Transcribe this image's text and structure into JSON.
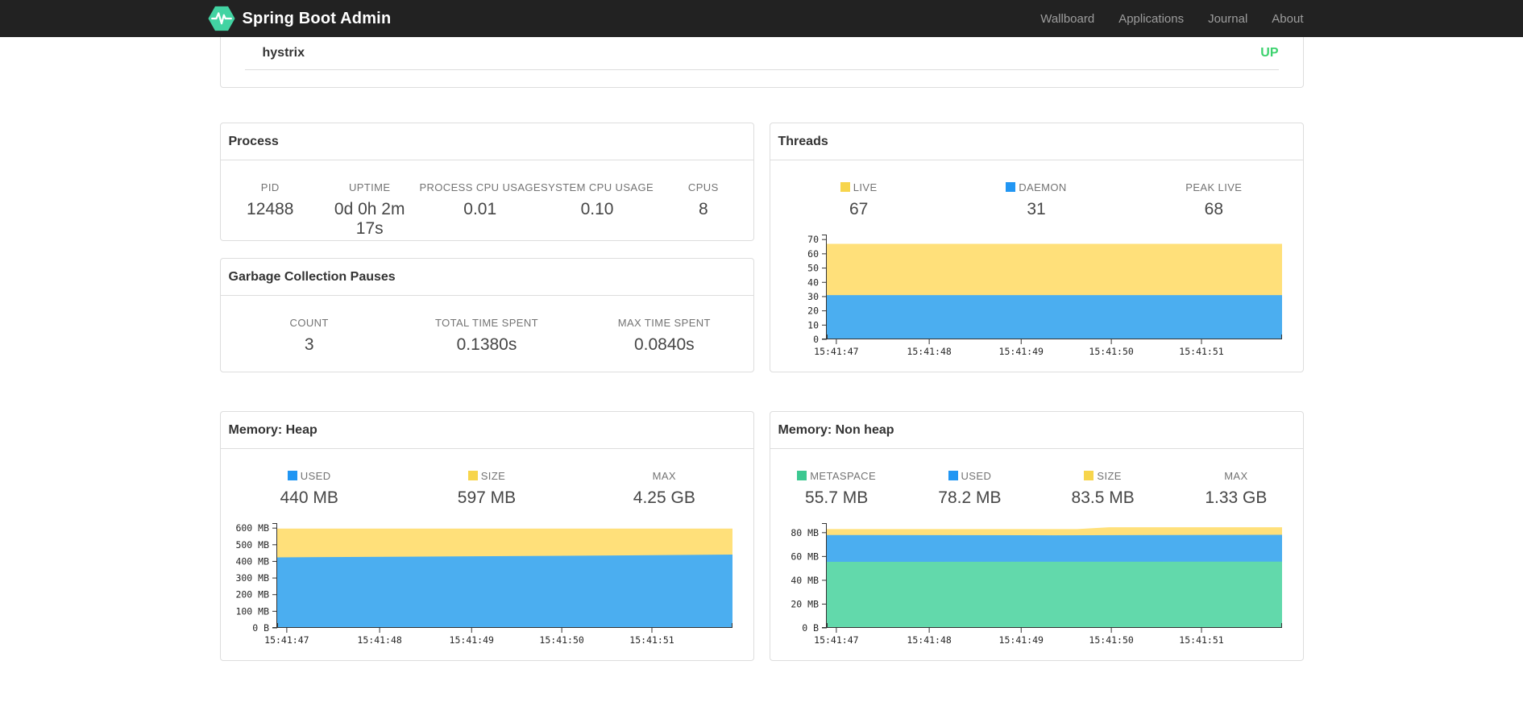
{
  "navbar": {
    "brand": "Spring Boot Admin",
    "items": [
      {
        "label": "Wallboard"
      },
      {
        "label": "Applications"
      },
      {
        "label": "Journal"
      },
      {
        "label": "About"
      }
    ]
  },
  "health": {
    "name": "hystrix",
    "status": "UP",
    "status_color": "#3cd26e"
  },
  "process": {
    "title": "Process",
    "stats": [
      {
        "label": "PID",
        "value": "12488"
      },
      {
        "label": "UPTIME",
        "value": "0d 0h 2m 17s"
      },
      {
        "label": "PROCESS CPU USAGE",
        "value": "0.01"
      },
      {
        "label": "SYSTEM CPU USAGE",
        "value": "0.10"
      },
      {
        "label": "CPUS",
        "value": "8"
      }
    ]
  },
  "gc": {
    "title": "Garbage Collection Pauses",
    "stats": [
      {
        "label": "COUNT",
        "value": "3"
      },
      {
        "label": "TOTAL TIME SPENT",
        "value": "0.1380s"
      },
      {
        "label": "MAX TIME SPENT",
        "value": "0.0840s"
      }
    ]
  },
  "threads": {
    "title": "Threads",
    "stats": [
      {
        "label": "LIVE",
        "value": "67",
        "marker": "#f7d54c"
      },
      {
        "label": "DAEMON",
        "value": "31",
        "marker": "#2196f3"
      },
      {
        "label": "PEAK LIVE",
        "value": "68"
      }
    ]
  },
  "memory_heap": {
    "title": "Memory: Heap",
    "stats": [
      {
        "label": "USED",
        "value": "440 MB",
        "marker": "#2196f3"
      },
      {
        "label": "SIZE",
        "value": "597 MB",
        "marker": "#f7d54c"
      },
      {
        "label": "MAX",
        "value": "4.25 GB"
      }
    ]
  },
  "memory_nonheap": {
    "title": "Memory: Non heap",
    "stats": [
      {
        "label": "METASPACE",
        "value": "55.7 MB",
        "marker": "#3cc891"
      },
      {
        "label": "USED",
        "value": "78.2 MB",
        "marker": "#2196f3"
      },
      {
        "label": "SIZE",
        "value": "83.5 MB",
        "marker": "#f7d54c"
      },
      {
        "label": "MAX",
        "value": "1.33 GB"
      }
    ]
  },
  "chart_data": [
    {
      "type": "area",
      "stacked": true,
      "title": "Threads",
      "xlabel": "",
      "ylabel": "",
      "grid": false,
      "legend_position": "above",
      "legend": [
        {
          "name": "LIVE",
          "value": 67,
          "color": "#ffe07a"
        },
        {
          "name": "DAEMON",
          "value": 31,
          "color": "#4baef0"
        },
        {
          "name": "PEAK LIVE",
          "value": 68
        }
      ],
      "ylim": [
        0,
        73.5
      ],
      "yticks": [
        {
          "v": 0,
          "label": "0"
        },
        {
          "v": 10,
          "label": "10"
        },
        {
          "v": 20,
          "label": "20"
        },
        {
          "v": 30,
          "label": "30"
        },
        {
          "v": 40,
          "label": "40"
        },
        {
          "v": 50,
          "label": "50"
        },
        {
          "v": 60,
          "label": "60"
        },
        {
          "v": 70,
          "label": "70"
        }
      ],
      "xticks": [
        {
          "f": 0.021,
          "label": "15:41:47"
        },
        {
          "f": 0.225,
          "label": "15:41:48"
        },
        {
          "f": 0.427,
          "label": "15:41:49"
        },
        {
          "f": 0.625,
          "label": "15:41:50"
        },
        {
          "f": 0.823,
          "label": "15:41:51"
        }
      ],
      "series": [
        {
          "name": "live",
          "color": "#ffe07a",
          "points": [
            [
              0,
              67
            ],
            [
              1,
              67
            ]
          ]
        },
        {
          "name": "daemon",
          "color": "#4baef0",
          "points": [
            [
              0,
              31
            ],
            [
              1,
              31
            ]
          ]
        }
      ]
    },
    {
      "type": "area",
      "stacked": true,
      "title": "Memory: Heap",
      "xlabel": "",
      "ylabel": "",
      "grid": false,
      "legend_position": "above",
      "legend": [
        {
          "name": "USED",
          "value": "440 MB",
          "color": "#4baef0"
        },
        {
          "name": "SIZE",
          "value": "597 MB",
          "color": "#ffe07a"
        },
        {
          "name": "MAX",
          "value": "4.25 GB"
        }
      ],
      "ylim": [
        0,
        630
      ],
      "yticks": [
        {
          "v": 0,
          "label": "0 B"
        },
        {
          "v": 100,
          "label": "100 MB"
        },
        {
          "v": 200,
          "label": "200 MB"
        },
        {
          "v": 300,
          "label": "300 MB"
        },
        {
          "v": 400,
          "label": "400 MB"
        },
        {
          "v": 500,
          "label": "500 MB"
        },
        {
          "v": 600,
          "label": "600 MB"
        }
      ],
      "xticks": [
        {
          "f": 0.021,
          "label": "15:41:47"
        },
        {
          "f": 0.225,
          "label": "15:41:48"
        },
        {
          "f": 0.427,
          "label": "15:41:49"
        },
        {
          "f": 0.625,
          "label": "15:41:50"
        },
        {
          "f": 0.823,
          "label": "15:41:51"
        }
      ],
      "series": [
        {
          "name": "size",
          "color": "#ffe07a",
          "points": [
            [
              0,
              597
            ],
            [
              1,
              597
            ]
          ]
        },
        {
          "name": "used",
          "color": "#4baef0",
          "points": [
            [
              0,
              424
            ],
            [
              0.2,
              427
            ],
            [
              0.4,
              430
            ],
            [
              0.6,
              433
            ],
            [
              0.8,
              437
            ],
            [
              1,
              441
            ]
          ]
        }
      ]
    },
    {
      "type": "area",
      "stacked": true,
      "title": "Memory: Non heap",
      "xlabel": "",
      "ylabel": "",
      "grid": false,
      "legend_position": "above",
      "legend": [
        {
          "name": "METASPACE",
          "value": "55.7 MB",
          "color": "#62d9ab"
        },
        {
          "name": "USED",
          "value": "78.2 MB",
          "color": "#4baef0"
        },
        {
          "name": "SIZE",
          "value": "83.5 MB",
          "color": "#ffe07a"
        },
        {
          "name": "MAX",
          "value": "1.33 GB"
        }
      ],
      "ylim": [
        0,
        88
      ],
      "yticks": [
        {
          "v": 0,
          "label": "0 B"
        },
        {
          "v": 20,
          "label": "20 MB"
        },
        {
          "v": 40,
          "label": "40 MB"
        },
        {
          "v": 60,
          "label": "60 MB"
        },
        {
          "v": 80,
          "label": "80 MB"
        }
      ],
      "xticks": [
        {
          "f": 0.021,
          "label": "15:41:47"
        },
        {
          "f": 0.225,
          "label": "15:41:48"
        },
        {
          "f": 0.427,
          "label": "15:41:49"
        },
        {
          "f": 0.625,
          "label": "15:41:50"
        },
        {
          "f": 0.823,
          "label": "15:41:51"
        }
      ],
      "series": [
        {
          "name": "size",
          "color": "#ffe07a",
          "points": [
            [
              0,
              83
            ],
            [
              0.55,
              83
            ],
            [
              0.62,
              84.5
            ],
            [
              1,
              84.5
            ]
          ]
        },
        {
          "name": "used",
          "color": "#4baef0",
          "points": [
            [
              0,
              78
            ],
            [
              0.5,
              77.8
            ],
            [
              1,
              78.2
            ]
          ]
        },
        {
          "name": "metaspace",
          "color": "#62d9ab",
          "points": [
            [
              0,
              55.5
            ],
            [
              1,
              55.7
            ]
          ]
        }
      ]
    }
  ]
}
